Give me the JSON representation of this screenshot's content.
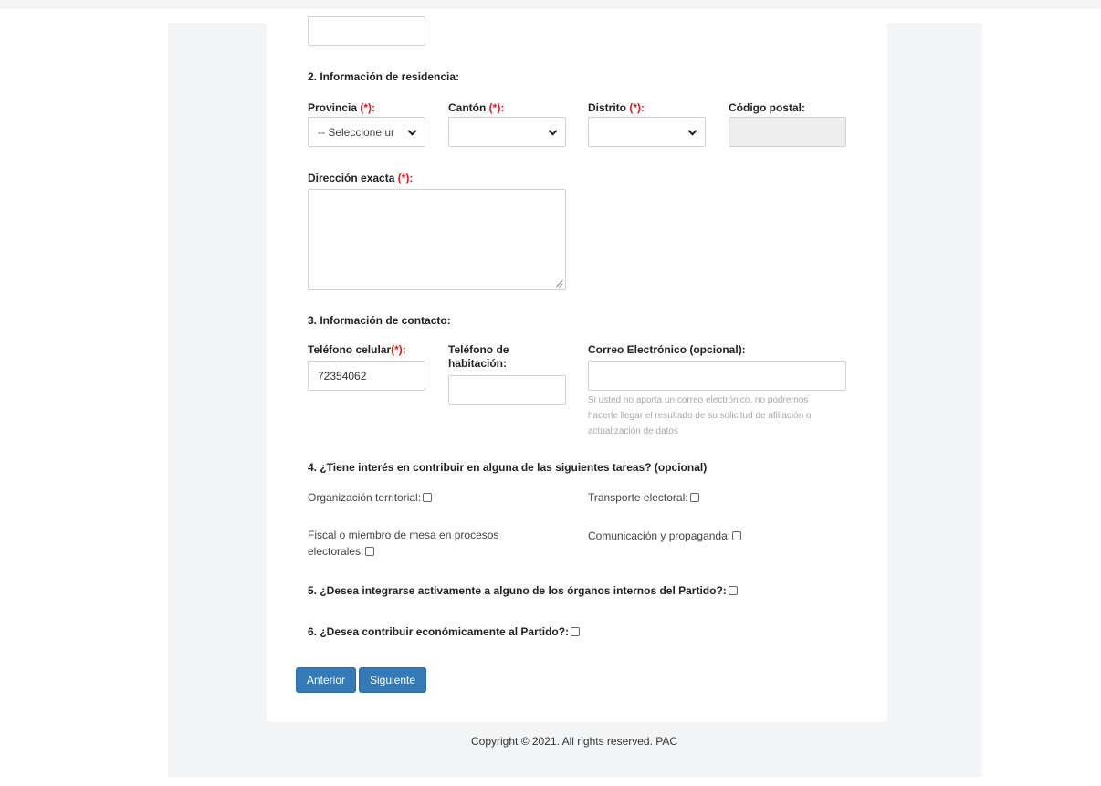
{
  "sections": {
    "residence": "2. Información de residencia:",
    "contact": "3. Información de contacto:",
    "tasks": "4. ¿Tiene interés en contribuir en alguna de las siguientes tareas? (opcional)",
    "organs": "5. ¿Desea integrarse activamente a alguno de los órganos internos del Partido?:",
    "economic": "6. ¿Desea contribuir económicamente al Partido?:"
  },
  "required_mark": "(*):",
  "residence": {
    "provincia_label": "Provincia",
    "provincia_value": "-- Seleccione ur",
    "canton_label": "Cantón",
    "distrito_label": "Distrito",
    "postal_label": "Código postal:",
    "direccion_label": "Dirección exacta"
  },
  "contact": {
    "celular_label": "Teléfono celular",
    "celular_value": "72354062",
    "habitacion_label_1": "Teléfono de",
    "habitacion_label_2": "habitación:",
    "correo_label": "Correo Electrónico (opcional):",
    "correo_help_1": "Si usted no aporta un correo electrónico, no podremos",
    "correo_help_2": "hacerle llegar el resultado de su solicitud de afiliación o",
    "correo_help_3": "actualización de datos"
  },
  "tasks": {
    "organizacion": "Organización territorial:",
    "transporte": "Transporte electoral:",
    "fiscal_1": "Fiscal o miembro de mesa en procesos",
    "fiscal_2": "electorales:",
    "comunicacion": "Comunicación y propaganda:"
  },
  "buttons": {
    "anterior": "Anterior",
    "siguiente": "Siguiente"
  },
  "footer": "Copyright © 2021. All rights reserved. PAC",
  "colors": {
    "required": "#e0181b",
    "button": "#337ab7",
    "page_bg": "#f2f4f6"
  }
}
